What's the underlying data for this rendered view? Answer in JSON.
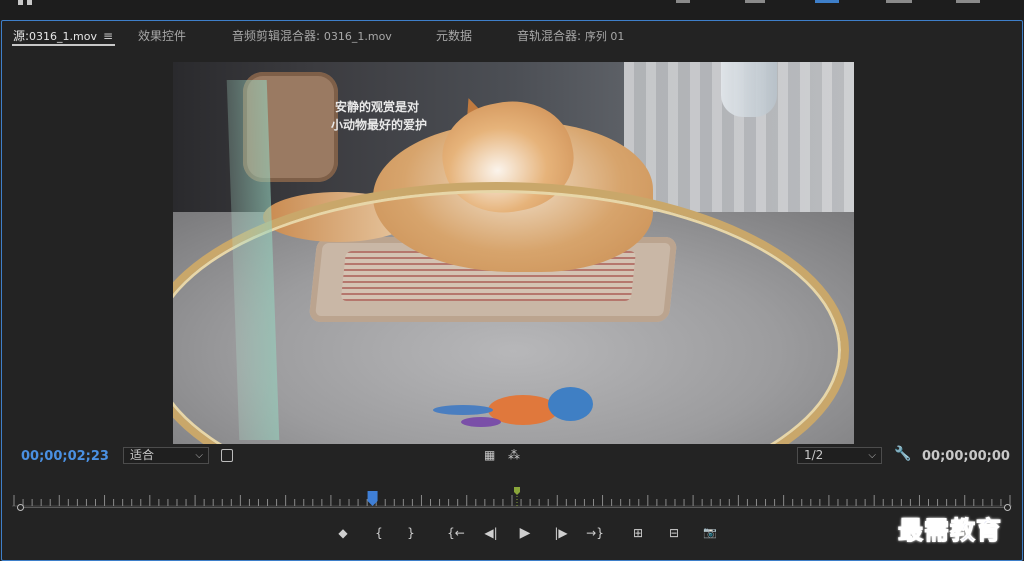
{
  "tabs": [
    {
      "label": "源:",
      "sub": "0316_1.mov",
      "active": true
    },
    {
      "label": "效果控件",
      "sub": "",
      "active": false
    },
    {
      "label": "音频剪辑混合器:",
      "sub": "0316_1.mov",
      "active": false
    },
    {
      "label": "元数据",
      "sub": "",
      "active": false
    },
    {
      "label": "音轨混合器:",
      "sub": "序列 01",
      "active": false
    }
  ],
  "video": {
    "sign_line1": "安静的观赏是对",
    "sign_line2": "小动物最好的爱护"
  },
  "transport": {
    "timecode_current": "00;00;02;23",
    "timecode_duration": "00;00;00;00",
    "zoom_select": "适合",
    "resolution_select": "1/2"
  },
  "playhead_position": 0.36,
  "controls": [
    {
      "name": "add-marker-button",
      "glyph": "◆"
    },
    {
      "name": "mark-in-button",
      "glyph": "{"
    },
    {
      "name": "mark-out-button",
      "glyph": "}"
    },
    {
      "name": "go-to-in-button",
      "glyph": "{←"
    },
    {
      "name": "step-back-button",
      "glyph": "◀|"
    },
    {
      "name": "play-button",
      "glyph": "▶"
    },
    {
      "name": "step-forward-button",
      "glyph": "|▶"
    },
    {
      "name": "go-to-out-button",
      "glyph": "→}"
    },
    {
      "name": "insert-button",
      "glyph": "⊞"
    },
    {
      "name": "overwrite-button",
      "glyph": "⊟"
    },
    {
      "name": "export-frame-button",
      "glyph": "📷"
    }
  ],
  "watermark": "最需教育",
  "colors": {
    "accent": "#3e7fc9",
    "timecode_blue": "#4a90e2",
    "background": "#232323",
    "marker_green": "#8aa63a",
    "playhead_blue": "#3f7fd6"
  }
}
